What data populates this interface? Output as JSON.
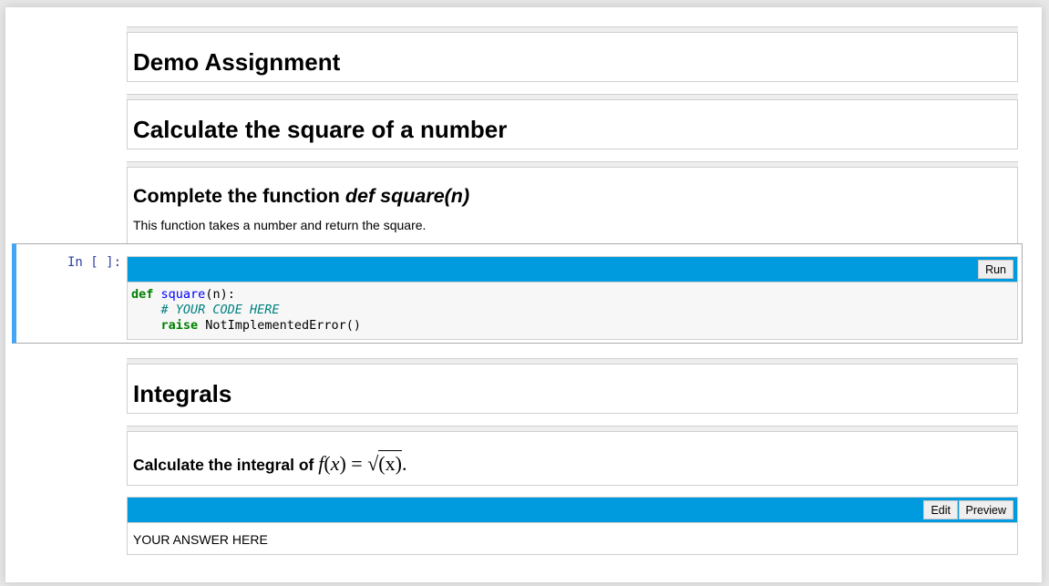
{
  "cells": {
    "title": "Demo Assignment",
    "section1": "Calculate the square of a number",
    "task": {
      "heading_prefix": "Complete the function ",
      "heading_code": "def square(n)",
      "description": "This function takes a number and return the square."
    },
    "code_cell": {
      "prompt": "In [ ]:",
      "run_label": "Run",
      "line1_kw": "def",
      "line1_fn": "square",
      "line1_rest": "(n):",
      "line2_comment": "# YOUR CODE HERE",
      "line3_kw": "raise",
      "line3_rest": "NotImplementedError()"
    },
    "section2": "Integrals",
    "integral": {
      "prefix": "Calculate the integral of ",
      "fx": "f",
      "lparen": "(",
      "x": "x",
      "rparen": ")",
      "equals": " = ",
      "sqrt": "√",
      "sqrt_arg": "(x)",
      "period": "."
    },
    "answer_cell": {
      "edit_label": "Edit",
      "preview_label": "Preview",
      "answer_text": "YOUR ANSWER HERE"
    }
  },
  "colors": {
    "toolbar_blue": "#009ade",
    "selected_border": "#42a5f5",
    "prompt_color": "#303f9f"
  }
}
